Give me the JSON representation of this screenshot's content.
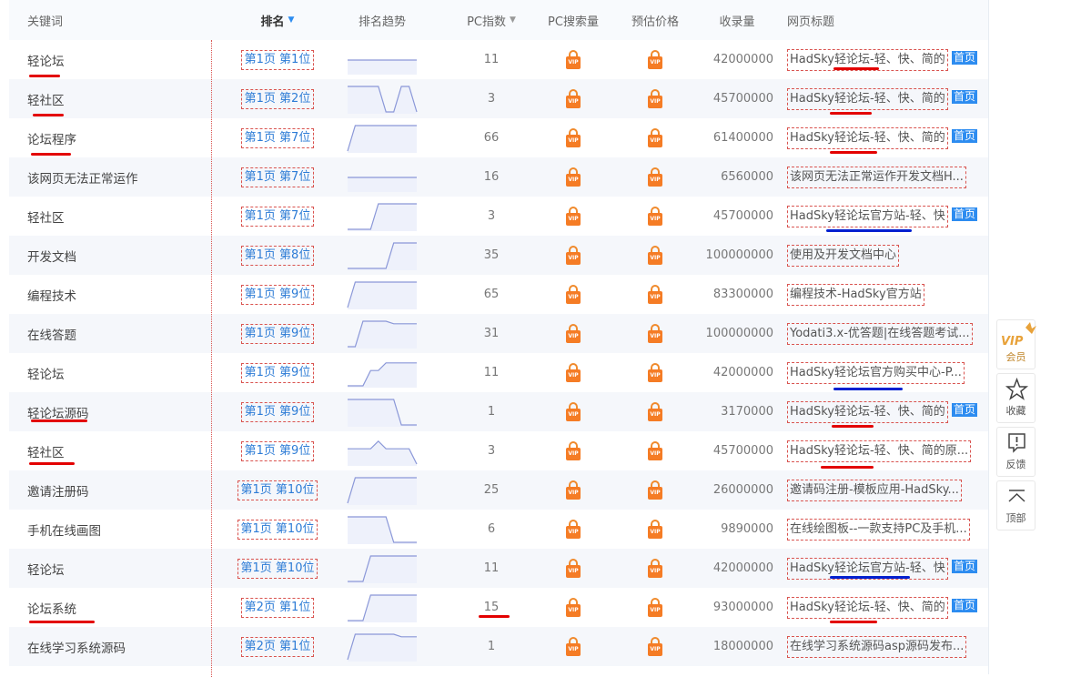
{
  "header": {
    "keyword": "关键词",
    "rank": "排名",
    "trend": "排名趋势",
    "pc_index": "PC指数",
    "pc_search_volume": "PC搜索量",
    "estimated_price": "预估价格",
    "indexed": "收录量",
    "page_title": "网页标题"
  },
  "rows": [
    {
      "keyword": "轻论坛",
      "rank": "第1页 第1位",
      "trend": [
        0.5,
        0.5,
        0.5,
        0.5,
        0.5,
        0.5,
        0.5,
        0.5,
        0.5,
        0.5
      ],
      "pc_index": "11",
      "indexed": "42000000",
      "title": "HadSky轻论坛-轻、快、简的",
      "home": true
    },
    {
      "keyword": "轻社区",
      "rank": "第1页 第2位",
      "trend": [
        1,
        1,
        1,
        1,
        1,
        0,
        0,
        1,
        1,
        0
      ],
      "pc_index": "3",
      "indexed": "45700000",
      "title": "HadSky轻论坛-轻、快、简的",
      "home": true
    },
    {
      "keyword": "论坛程序",
      "rank": "第1页 第7位",
      "trend": [
        0,
        1,
        1,
        1,
        1,
        1,
        1,
        1,
        1,
        1
      ],
      "pc_index": "66",
      "indexed": "61400000",
      "title": "HadSky轻论坛-轻、快、简的",
      "home": true
    },
    {
      "keyword": "该网页无法正常运作",
      "rank": "第1页 第7位",
      "trend": [
        0.5,
        0.5,
        0.5,
        0.5,
        0.5,
        0.5,
        0.5,
        0.5,
        0.5,
        0.5
      ],
      "pc_index": "16",
      "indexed": "6560000",
      "title": "该网页无法正常运作开发文档H...",
      "home": false
    },
    {
      "keyword": "轻社区",
      "rank": "第1页 第7位",
      "trend": [
        0,
        0,
        0,
        0,
        1,
        1,
        1,
        1,
        1,
        1
      ],
      "pc_index": "3",
      "indexed": "45700000",
      "title": "HadSky轻论坛官方站-轻、快",
      "home": true
    },
    {
      "keyword": "开发文档",
      "rank": "第1页 第8位",
      "trend": [
        0,
        0,
        0,
        0,
        0,
        0,
        1,
        1,
        1,
        1
      ],
      "pc_index": "35",
      "indexed": "100000000",
      "title": "使用及开发文档中心",
      "home": false
    },
    {
      "keyword": "编程技术",
      "rank": "第1页 第9位",
      "trend": [
        0,
        1,
        1,
        1,
        1,
        1,
        1,
        1,
        1,
        1
      ],
      "pc_index": "65",
      "indexed": "83300000",
      "title": "编程技术-HadSky官方站",
      "home": false
    },
    {
      "keyword": "在线答题",
      "rank": "第1页 第9位",
      "trend": [
        0,
        0,
        1,
        1,
        1,
        1,
        0.9,
        0.9,
        0.9,
        0.9
      ],
      "pc_index": "31",
      "indexed": "100000000",
      "title": "Yodati3.x-优答题|在线答题考试...",
      "home": false
    },
    {
      "keyword": "轻论坛",
      "rank": "第1页 第9位",
      "trend": [
        0,
        0,
        0,
        0.6,
        0.6,
        0.9,
        0.9,
        0.9,
        0.9,
        0.9
      ],
      "pc_index": "11",
      "indexed": "42000000",
      "title": "HadSky轻论坛官方购买中心-P...",
      "home": false
    },
    {
      "keyword": "轻论坛源码",
      "rank": "第1页 第9位",
      "trend": [
        1,
        1,
        1,
        1,
        1,
        1,
        1,
        0,
        0,
        0
      ],
      "pc_index": "1",
      "indexed": "3170000",
      "title": "HadSky轻论坛-轻、快、简的",
      "home": true
    },
    {
      "keyword": "轻社区",
      "rank": "第1页 第9位",
      "trend": [
        0.6,
        0.6,
        0.6,
        0.6,
        0.9,
        0.6,
        0.6,
        0.6,
        0.6,
        0
      ],
      "pc_index": "3",
      "indexed": "45700000",
      "title": "HadSky轻论坛-轻、快、简的原...",
      "home": false
    },
    {
      "keyword": "邀请注册码",
      "rank": "第1页 第10位",
      "trend": [
        0,
        1,
        1,
        1,
        1,
        1,
        1,
        1,
        1,
        1
      ],
      "pc_index": "25",
      "indexed": "26000000",
      "title": "邀请码注册-模板应用-HadSky...",
      "home": false
    },
    {
      "keyword": "手机在线画图",
      "rank": "第1页 第10位",
      "trend": [
        1,
        1,
        1,
        1,
        1,
        1,
        0,
        0,
        0,
        0
      ],
      "pc_index": "6",
      "indexed": "9890000",
      "title": "在线绘图板--一款支持PC及手机...",
      "home": false
    },
    {
      "keyword": "轻论坛",
      "rank": "第1页 第10位",
      "trend": [
        0,
        0,
        0,
        1,
        1,
        1,
        1,
        1,
        1,
        1
      ],
      "pc_index": "11",
      "indexed": "42000000",
      "title": "HadSky轻论坛官方站-轻、快",
      "home": true
    },
    {
      "keyword": "论坛系统",
      "rank": "第2页 第1位",
      "trend": [
        0,
        0,
        0,
        1,
        1,
        1,
        1,
        1,
        1,
        1
      ],
      "pc_index": "15",
      "indexed": "93000000",
      "title": "HadSky轻论坛-轻、快、简的",
      "home": true
    },
    {
      "keyword": "在线学习系统源码",
      "rank": "第2页 第1位",
      "trend": [
        0,
        1,
        1,
        1,
        1,
        1,
        1,
        0.9,
        0.9,
        0.9
      ],
      "pc_index": "1",
      "indexed": "18000000",
      "title": "在线学习系统源码asp源码发布...",
      "home": false
    }
  ],
  "home_label": "首页",
  "vip_label": "VIP",
  "sidebar": {
    "member": "会员",
    "member_logo": "VIP",
    "favorite": "收藏",
    "feedback": "反馈",
    "top": "顶部"
  },
  "colors": {
    "accent": "#2d8cf0",
    "vip_orange": "#f57c25",
    "annotation_red": "#e30000",
    "annotation_blue": "#0020d0"
  }
}
